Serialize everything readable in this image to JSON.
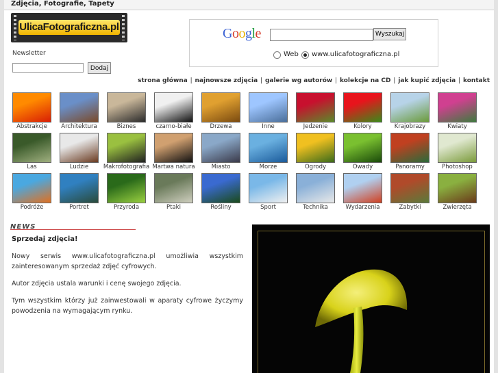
{
  "header": {
    "title": "Zdjęcia, Fotografie, Tapety"
  },
  "logo": {
    "text": "UlicaFotograficzna.pl"
  },
  "newsletter": {
    "label": "Newsletter",
    "value": "",
    "button": "Dodaj"
  },
  "google": {
    "logo_letters": [
      "G",
      "o",
      "o",
      "g",
      "l",
      "e"
    ],
    "logo_colors": [
      "#3b62d4",
      "#d63c2c",
      "#e8b100",
      "#3b62d4",
      "#1d9a3c",
      "#d63c2c"
    ],
    "query": "",
    "button": "Wyszukaj",
    "options": [
      {
        "label": "Web",
        "selected": false
      },
      {
        "label": "www.ulicafotograficzna.pl",
        "selected": true
      }
    ]
  },
  "nav": [
    "strona główna",
    "najnowsze zdjęcia",
    "galerie wg autorów",
    "kolekcje na CD",
    "jak kupić zdjęcia",
    "kontakt"
  ],
  "categories": [
    {
      "label": "Abstrakcje",
      "colors": [
        "#ff8a00",
        "#d81e05"
      ]
    },
    {
      "label": "Architektura",
      "colors": [
        "#6a8fc8",
        "#7a4a2a"
      ]
    },
    {
      "label": "Biznes",
      "colors": [
        "#c9b79a",
        "#2b2b2b"
      ]
    },
    {
      "label": "czarno-białe",
      "colors": [
        "#f0f0f0",
        "#111111"
      ]
    },
    {
      "label": "Drzewa",
      "colors": [
        "#e0a030",
        "#7a4a10"
      ]
    },
    {
      "label": "Inne",
      "colors": [
        "#9ec6ff",
        "#4a6e9a"
      ]
    },
    {
      "label": "Jedzenie",
      "colors": [
        "#c8102e",
        "#5a8a2a"
      ]
    },
    {
      "label": "Kolory",
      "colors": [
        "#e8141c",
        "#3a8a1a"
      ]
    },
    {
      "label": "Krajobrazy",
      "colors": [
        "#b7d3e8",
        "#6a9a3a"
      ]
    },
    {
      "label": "Kwiaty",
      "colors": [
        "#d04090",
        "#3e7a3e"
      ]
    },
    {
      "label": "Las",
      "colors": [
        "#3a5a2a",
        "#a0b080"
      ]
    },
    {
      "label": "Ludzie",
      "colors": [
        "#e8e8e8",
        "#6a3a20"
      ]
    },
    {
      "label": "Makrofotografia",
      "colors": [
        "#9ac040",
        "#202020"
      ]
    },
    {
      "label": "Martwa natura",
      "colors": [
        "#d0a070",
        "#111111"
      ]
    },
    {
      "label": "Miasto",
      "colors": [
        "#8aa8c8",
        "#3a3a4a"
      ]
    },
    {
      "label": "Morze",
      "colors": [
        "#6ab0e0",
        "#1a5a9a"
      ]
    },
    {
      "label": "Ogrody",
      "colors": [
        "#f0c020",
        "#3a6a1a"
      ]
    },
    {
      "label": "Owady",
      "colors": [
        "#7ac030",
        "#1a4a0a"
      ]
    },
    {
      "label": "Panoramy",
      "colors": [
        "#c04020",
        "#2a6a3a"
      ]
    },
    {
      "label": "Photoshop",
      "colors": [
        "#e0e8d0",
        "#7a9a3a"
      ]
    },
    {
      "label": "Podróże",
      "colors": [
        "#4aa8e0",
        "#e07020"
      ]
    },
    {
      "label": "Portret",
      "colors": [
        "#3080c0",
        "#2a4a3a"
      ]
    },
    {
      "label": "Przyroda",
      "colors": [
        "#2a6a1a",
        "#9ad040"
      ]
    },
    {
      "label": "Ptaki",
      "colors": [
        "#6a7a5a",
        "#cfcfbf"
      ]
    },
    {
      "label": "Rośliny",
      "colors": [
        "#3a6ad0",
        "#1a4a1a"
      ]
    },
    {
      "label": "Sport",
      "colors": [
        "#7ab8e8",
        "#f0f0f0"
      ]
    },
    {
      "label": "Technika",
      "colors": [
        "#8ab0d8",
        "#e8e8e8"
      ]
    },
    {
      "label": "Wydarzenia",
      "colors": [
        "#b0d0f0",
        "#d04020"
      ]
    },
    {
      "label": "Zabytki",
      "colors": [
        "#b04a2a",
        "#5a7a3a"
      ]
    },
    {
      "label": "Zwierzęta",
      "colors": [
        "#8ab040",
        "#6a3a1a"
      ]
    }
  ],
  "news": {
    "section_title": "NEWS",
    "headline": "Sprzedaj zdjęcia!",
    "paragraphs": [
      "Nowy serwis www.ulicafotograficzna.pl umożliwia wszystkim zainteresowanym sprzedaż zdjęć cyfrowych.",
      "Autor zdjęcia ustala warunki i cenę swojego zdjęcia.",
      "Tym wszystkim którzy już zainwestowali w aparaty cyfrowe życzymy powodzenia na wymagającym rynku."
    ]
  }
}
